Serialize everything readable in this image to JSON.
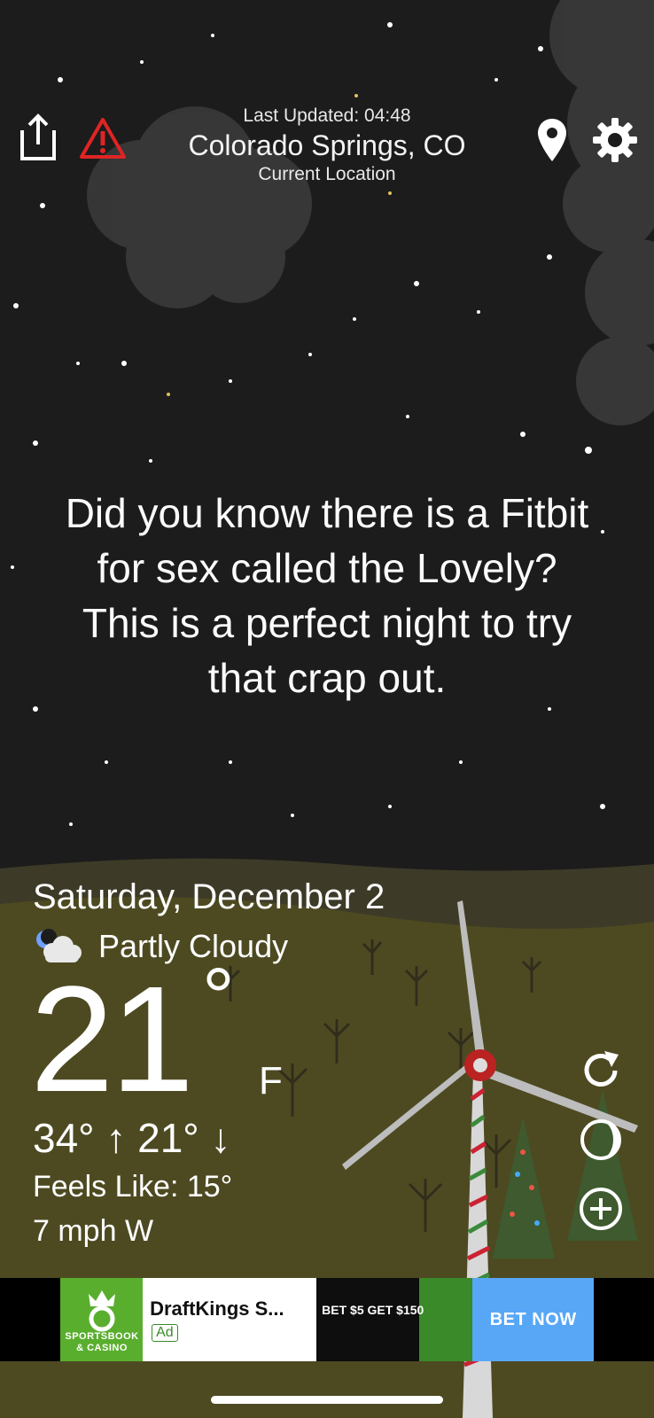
{
  "header": {
    "last_updated": "Last Updated: 04:48",
    "city": "Colorado Springs, CO",
    "location_label": "Current Location",
    "left_icons": [
      "share-icon",
      "alert-icon"
    ],
    "right_icons": [
      "location-pin-icon",
      "gear-icon"
    ]
  },
  "quip": {
    "line1": "Did you know there is a Fitbit",
    "line2": "for sex called the Lovely?",
    "line3": "This is a perfect night to try",
    "line4": "that crap out."
  },
  "weather": {
    "date": "Saturday, December 2",
    "condition": "Partly Cloudy",
    "condition_icon": "partly-cloudy-night-icon",
    "temperature": "21",
    "degree_symbol": "°",
    "unit": "F",
    "high_low": "34° ↑ 21° ↓",
    "feels_like": "Feels Like: 15°",
    "wind": "7 mph W"
  },
  "side_buttons": [
    "refresh-icon",
    "moon-phase-icon",
    "add-icon"
  ],
  "ad": {
    "brand_caption_1": "SPORTSBOOK",
    "brand_caption_2": "& CASINO",
    "title": "DraftKings S...",
    "badge": "Ad",
    "banner_offer": "BET $5 GET $150",
    "cta": "BET NOW"
  },
  "colors": {
    "sky": "#1c1c1c",
    "ground": "#4d4a22",
    "alert": "#e02424",
    "ad_green": "#5aae2e",
    "ad_cta": "#58a7f7"
  }
}
